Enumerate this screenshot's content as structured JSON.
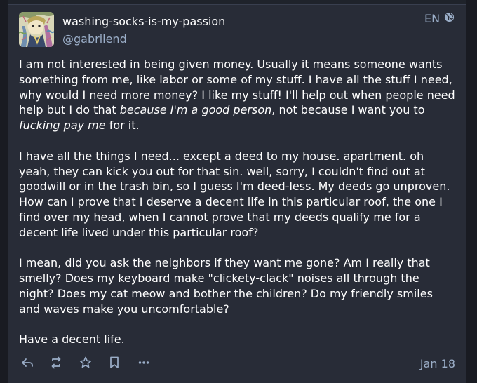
{
  "account": {
    "display_name": "washing-socks-is-my-passion",
    "handle": "@gabrilend",
    "avatar_icon": "avatar-illustration"
  },
  "post": {
    "language": "EN",
    "visibility_icon": "globe-icon",
    "paragraph1": {
      "part1": "I am not interested in being given money. Usually it means someone wants something from me, like labor or some of my stuff. I have all the stuff I need, why would I need more money? I like my stuff! I'll help out when people need help but I do that ",
      "em1": "because I'm a good person",
      "part2": ", not because I want you to ",
      "em2": "fucking pay me",
      "part3": " for it."
    },
    "paragraph2": "I have all the things I need... except a deed to my house. apartment. oh yeah, they can kick you out for that sin. well, sorry, I couldn't find out at goodwill or in the trash bin, so I guess I'm deed-less. My deeds go unproven. How can I prove that I deserve a decent life in this particular roof, the one I find over my head, when I cannot prove that my deeds qualify me for a decent life lived under this particular roof?",
    "paragraph3": "I mean, did you ask the neighbors if they want me gone? Am I really that smelly? Does my keyboard make \"clickety-clack\" noises all through the night? Does my cat meow and bother the children? Do my friendly smiles and waves make you uncomfortable?",
    "paragraph4": "Have a decent life.",
    "timestamp": "Jan 18"
  },
  "actions": [
    {
      "name": "reply-button",
      "icon": "reply-icon"
    },
    {
      "name": "boost-button",
      "icon": "boost-icon"
    },
    {
      "name": "favourite-button",
      "icon": "star-icon"
    },
    {
      "name": "bookmark-button",
      "icon": "bookmark-icon"
    },
    {
      "name": "more-button",
      "icon": "ellipsis-icon"
    }
  ],
  "colors": {
    "background": "#191b22",
    "card": "#282c37",
    "text": "#ffffff",
    "muted": "#9baec8"
  }
}
